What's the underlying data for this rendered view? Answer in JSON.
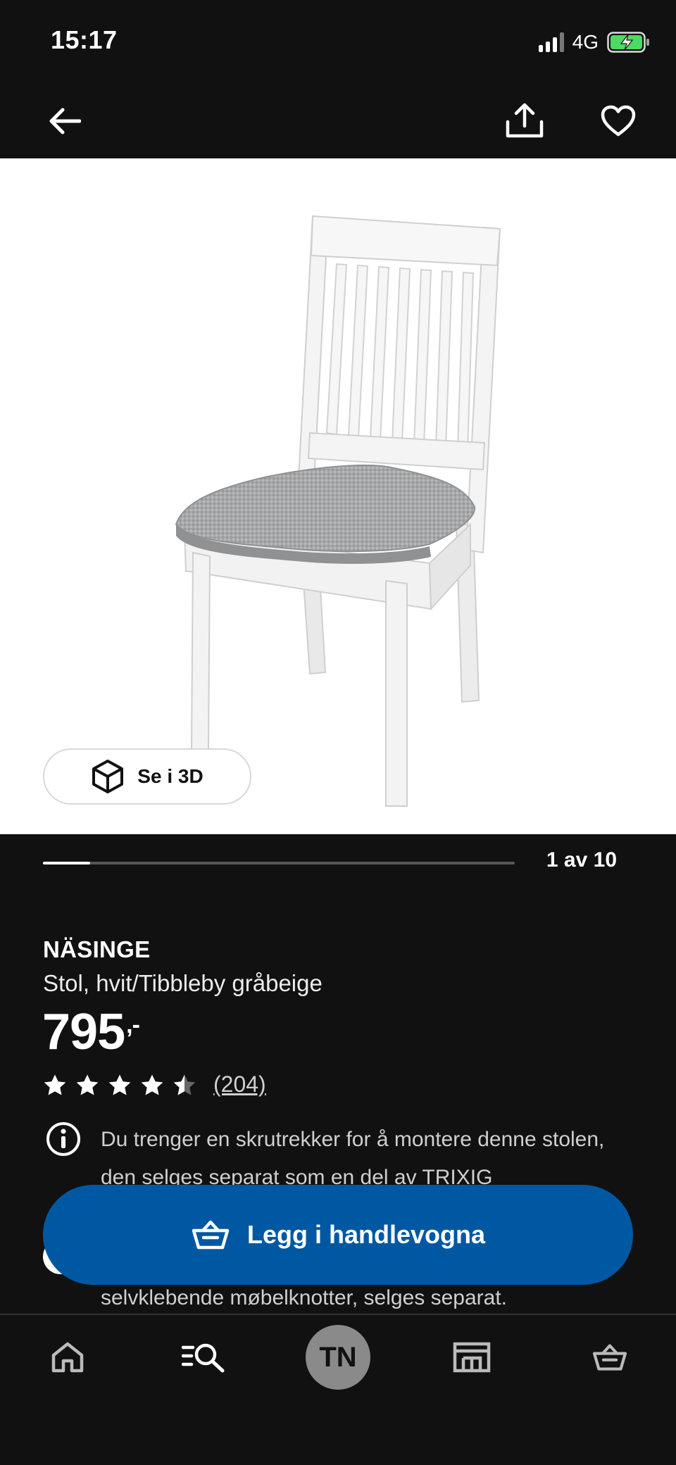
{
  "status_bar": {
    "time": "15:17",
    "network": "4G"
  },
  "gallery": {
    "see_3d_label": "Se i 3D",
    "page_indicator": "1 av 10",
    "progress_fraction": 0.1
  },
  "product": {
    "name": "NÄSINGE",
    "description": "Stol, hvit/Tibbleby gråbeige",
    "price": "795",
    "price_suffix": ",-",
    "rating": 4.5,
    "rating_max": 5,
    "review_count": "(204)",
    "info_text": "Du trenger en skrutrekker for å montere denne stolen, den selges separat som en del av TRIXIG",
    "info_text_last": "selvklebende møbelknotter, selges separat."
  },
  "cta": {
    "label": "Legg i handlevogna"
  },
  "tab_bar": {
    "avatar_initials": "TN"
  },
  "colors": {
    "background": "#111111",
    "accent": "#0058a3",
    "avatar": "#8a8a8a"
  }
}
